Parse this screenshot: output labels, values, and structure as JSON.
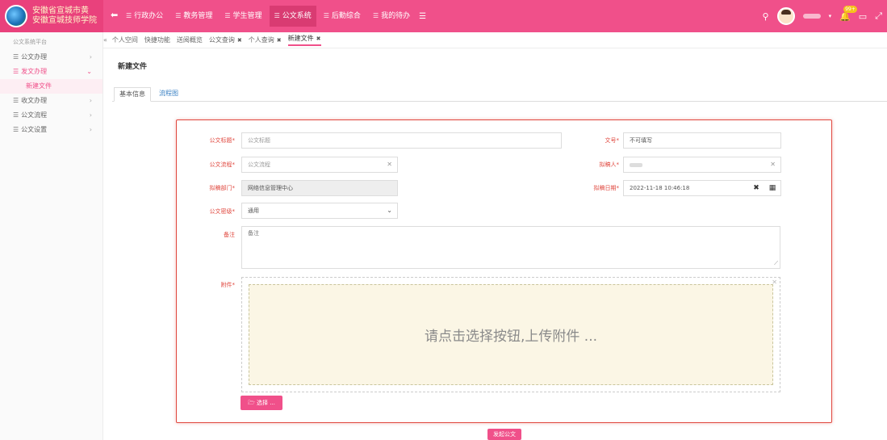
{
  "colors": {
    "brand": "#f0508a",
    "required": "#e0483f",
    "link": "#3b82c4"
  },
  "logo": {
    "line1": "安徽省宣城市黄",
    "line2": "安徽宣城技师学院"
  },
  "nav": {
    "back_icon": "arrow-left-icon",
    "items": [
      {
        "label": "行政办公",
        "active": false
      },
      {
        "label": "教务管理",
        "active": false
      },
      {
        "label": "学生管理",
        "active": false
      },
      {
        "label": "公文系统",
        "active": true
      },
      {
        "label": "后勤综合",
        "active": false
      },
      {
        "label": "我的待办",
        "active": false
      }
    ]
  },
  "topright": {
    "badge": "99+"
  },
  "sidebar": {
    "heading": "公文系统平台",
    "items": [
      {
        "label": "公文办理",
        "active": false
      },
      {
        "label": "发文办理",
        "active": true
      },
      {
        "label": "收文办理",
        "active": false
      },
      {
        "label": "公文流程",
        "active": false
      },
      {
        "label": "公文设置",
        "active": false
      }
    ],
    "sub_item": "新建文件"
  },
  "tabs": [
    {
      "label": "个人空间",
      "closable": false,
      "active": false
    },
    {
      "label": "快捷功能",
      "closable": false,
      "active": false
    },
    {
      "label": "送阅概览",
      "closable": false,
      "active": false
    },
    {
      "label": "公文查询",
      "closable": true,
      "active": false
    },
    {
      "label": "个人查询",
      "closable": true,
      "active": false
    },
    {
      "label": "新建文件",
      "closable": true,
      "active": true
    }
  ],
  "page": {
    "title": "新建文件",
    "subtabs": {
      "basic": "基本信息",
      "flow": "流程图"
    }
  },
  "form": {
    "title_label": "公文标题",
    "title_placeholder": "公文标题",
    "docno_label": "文号",
    "docno_value": "不可填写",
    "flow_label": "公文流程",
    "flow_placeholder": "公文流程",
    "drafter_label": "拟稿人",
    "dept_label": "拟稿部门",
    "dept_value": "网络信息管理中心",
    "date_label": "拟稿日期",
    "date_value": "2022-11-18 10:46:18",
    "secret_label": "公文密级",
    "secret_value": "通用",
    "remark_label": "备注",
    "remark_value": "备注",
    "attach_label": "附件",
    "attach_hint": "请点击选择按钮,上传附件 ...",
    "choose_label": "选择 ...",
    "submit_label": "发起公文"
  }
}
